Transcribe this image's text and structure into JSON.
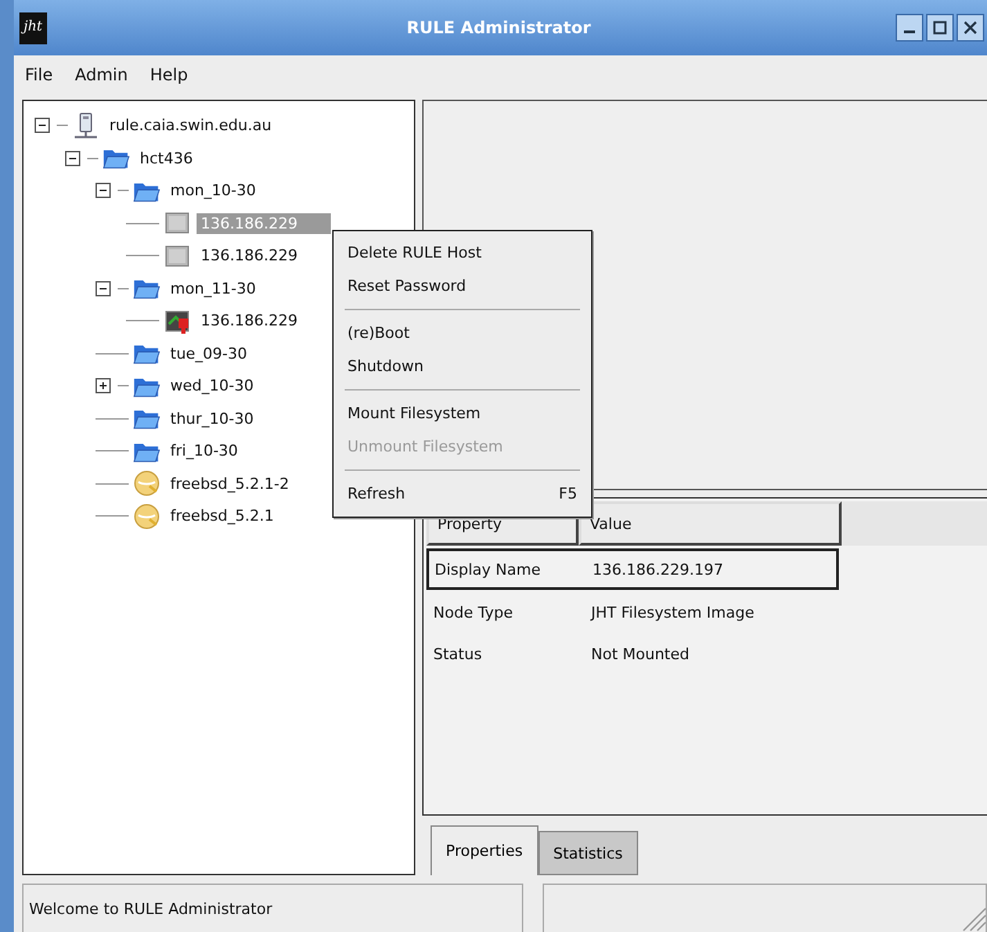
{
  "window": {
    "title": "RULE Administrator",
    "logo": "jht"
  },
  "menu_bar": [
    "File",
    "Admin",
    "Help"
  ],
  "tree": [
    {
      "label": "rule.caia.swin.edu.au",
      "kind": "host",
      "expanded": true,
      "selected": false,
      "children": [
        {
          "label": "hct436",
          "kind": "folder",
          "expanded": true,
          "selected": false,
          "children": [
            {
              "label": "mon_10-30",
              "kind": "folder",
              "expanded": true,
              "selected": false,
              "children": [
                {
                  "label": "136.186.229",
                  "kind": "image",
                  "selected": true
                },
                {
                  "label": "136.186.229",
                  "kind": "image",
                  "selected": false
                }
              ]
            },
            {
              "label": "mon_11-30",
              "kind": "folder",
              "expanded": true,
              "selected": false,
              "children": [
                {
                  "label": "136.186.229",
                  "kind": "image-error",
                  "selected": false
                }
              ]
            },
            {
              "label": "tue_09-30",
              "kind": "folder",
              "selected": false
            },
            {
              "label": "wed_10-30",
              "kind": "folder",
              "expanded": false,
              "selected": false
            },
            {
              "label": "thur_10-30",
              "kind": "folder",
              "selected": false
            },
            {
              "label": "fri_10-30",
              "kind": "folder",
              "selected": false
            },
            {
              "label": "freebsd_5.2.1-2",
              "kind": "os",
              "selected": false
            },
            {
              "label": "freebsd_5.2.1",
              "kind": "os",
              "selected": false
            }
          ]
        }
      ]
    }
  ],
  "context_menu": [
    {
      "kind": "item",
      "label": "Delete RULE Host",
      "disabled": false
    },
    {
      "kind": "item",
      "label": "Reset Password",
      "disabled": false
    },
    {
      "kind": "separator"
    },
    {
      "kind": "item",
      "label": "(re)Boot",
      "disabled": false
    },
    {
      "kind": "item",
      "label": "Shutdown",
      "disabled": false
    },
    {
      "kind": "separator"
    },
    {
      "kind": "item",
      "label": "Mount Filesystem",
      "disabled": false
    },
    {
      "kind": "item",
      "label": "Unmount Filesystem",
      "disabled": true
    },
    {
      "kind": "separator"
    },
    {
      "kind": "item",
      "label": "Refresh",
      "shortcut": "F5",
      "disabled": false
    }
  ],
  "properties": {
    "columns": [
      "Property",
      "Value"
    ],
    "rows": [
      {
        "property": "Display Name",
        "value": "136.186.229.197",
        "selected": true
      },
      {
        "property": "Node Type",
        "value": "JHT Filesystem Image",
        "selected": false
      },
      {
        "property": "Status",
        "value": "Not Mounted",
        "selected": false
      }
    ]
  },
  "tabs": [
    {
      "label": "Properties",
      "selected": true
    },
    {
      "label": "Statistics",
      "selected": false
    }
  ],
  "status_bar": {
    "message": "Welcome to RULE Administrator"
  }
}
